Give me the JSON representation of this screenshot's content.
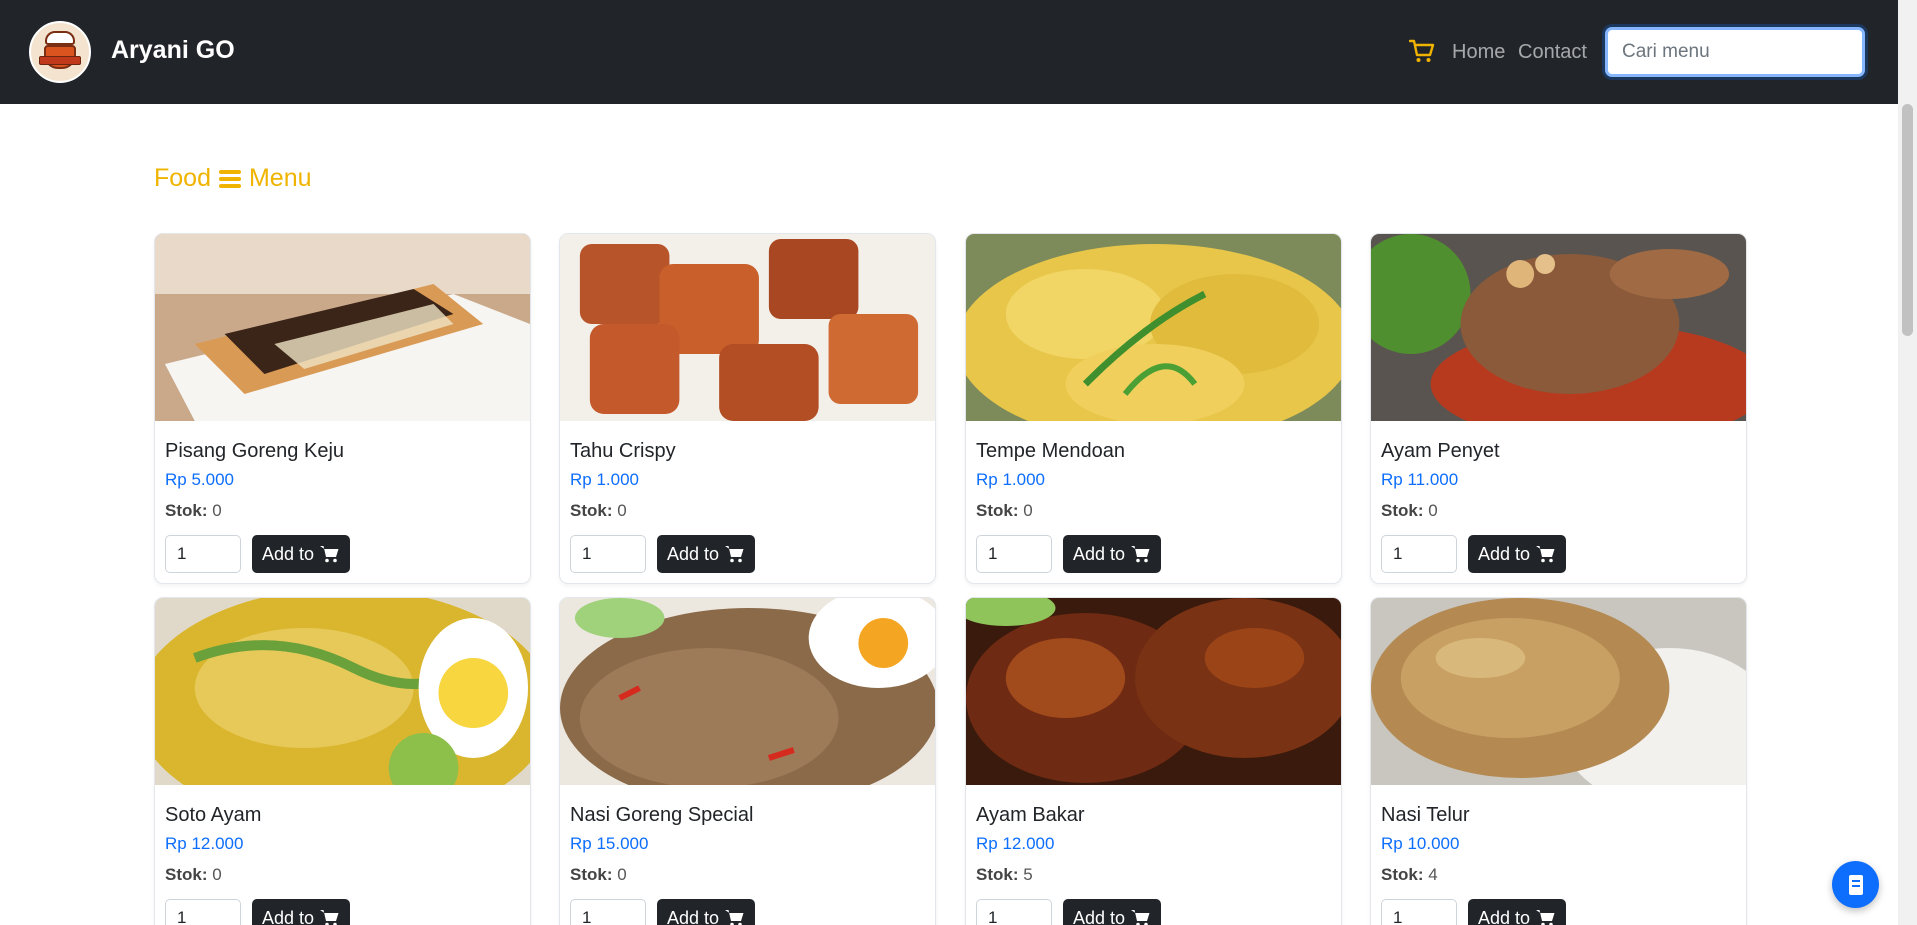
{
  "brand": {
    "name": "Aryani GO"
  },
  "nav": {
    "home": "Home",
    "contact": "Contact",
    "search_placeholder": "Cari menu"
  },
  "section": {
    "title_left": "Food",
    "title_right": "Menu"
  },
  "labels": {
    "stock": "Stok:",
    "add_to": "Add to"
  },
  "colors": {
    "accent": "#f0b400",
    "price": "#0d6efd",
    "dark": "#212529",
    "fab": "#0d6efd"
  },
  "products": [
    {
      "name": "Pisang Goreng Keju",
      "price": "Rp 5.000",
      "stock": "0",
      "qty": "1",
      "image": "pisang-goreng-keju-photo"
    },
    {
      "name": "Tahu Crispy",
      "price": "Rp 1.000",
      "stock": "0",
      "qty": "1",
      "image": "tahu-crispy-photo"
    },
    {
      "name": "Tempe Mendoan",
      "price": "Rp 1.000",
      "stock": "0",
      "qty": "1",
      "image": "tempe-mendoan-photo"
    },
    {
      "name": "Ayam Penyet",
      "price": "Rp 11.000",
      "stock": "0",
      "qty": "1",
      "image": "ayam-penyet-photo"
    },
    {
      "name": "Soto Ayam",
      "price": "Rp 12.000",
      "stock": "0",
      "qty": "1",
      "image": "soto-ayam-photo"
    },
    {
      "name": "Nasi Goreng Special",
      "price": "Rp 15.000",
      "stock": "0",
      "qty": "1",
      "image": "nasi-goreng-special-photo"
    },
    {
      "name": "Ayam Bakar",
      "price": "Rp 12.000",
      "stock": "5",
      "qty": "1",
      "image": "ayam-bakar-photo"
    },
    {
      "name": "Nasi Telur",
      "price": "Rp 10.000",
      "stock": "4",
      "qty": "1",
      "image": "nasi-telur-photo"
    }
  ],
  "icons": {
    "cart": "cart-icon",
    "menu": "bars-icon",
    "fab": "receipt-icon"
  }
}
